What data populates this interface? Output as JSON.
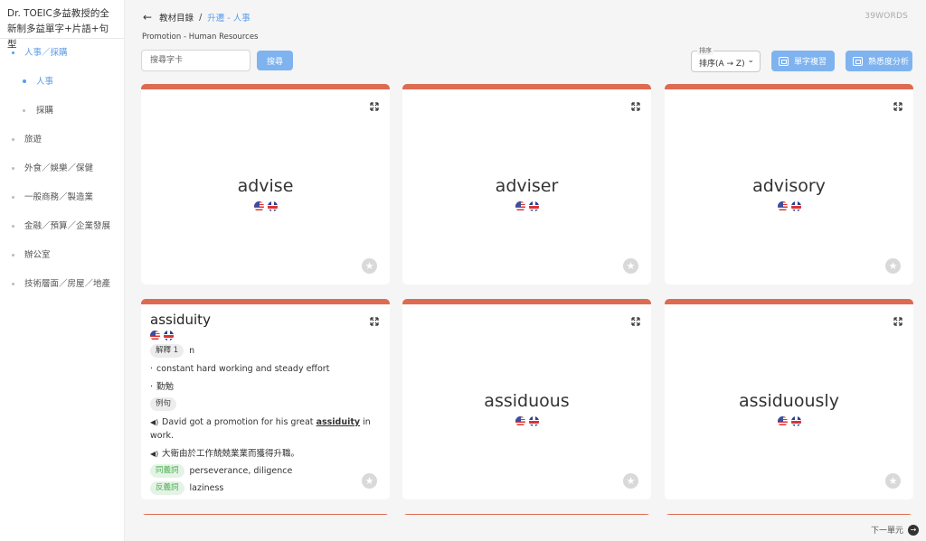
{
  "sidebar": {
    "title": "Dr. TOEIC多益教授的全新制多益單字+片語+句型",
    "items": [
      {
        "label": "人事／採購",
        "active": true
      },
      {
        "label": "人事",
        "active": true,
        "sub": true
      },
      {
        "label": "採購",
        "sub": true
      },
      {
        "label": "旅遊"
      },
      {
        "label": "外食／娛樂／保健"
      },
      {
        "label": "一般商務／製造業"
      },
      {
        "label": "金融／預算／企業發展"
      },
      {
        "label": "辦公室"
      },
      {
        "label": "技術層面／房屋／地產"
      }
    ]
  },
  "header": {
    "back_icon": "←",
    "breadcrumb_root": "教材目錄",
    "breadcrumb_sep": "/",
    "breadcrumb_current": "升遷 - 人事",
    "word_count": "39WORDS",
    "subtitle": "Promotion - Human Resources"
  },
  "toolbar": {
    "search_placeholder": "搜尋字卡",
    "search_button": "搜尋",
    "sort_legend": "排序",
    "sort_value": "排序(A → Z)",
    "sort_chevron": "⌄",
    "review_button": "單字複習",
    "analysis_button": "熟悉度分析"
  },
  "cards": [
    {
      "word": "advise"
    },
    {
      "word": "adviser"
    },
    {
      "word": "advisory"
    },
    {
      "word": "assiduity",
      "sense_chip": "解釋 1",
      "pos": "n",
      "definition_en": "constant hard working and steady effort",
      "definition_zh": "勤勉",
      "example_chip": "例句",
      "example_en_before": "David got a promotion for his great",
      "example_en_word": "assiduity",
      "example_en_after": "in work.",
      "example_zh": "大衛由於工作兢兢業業而獲得升職。",
      "synonym_chip": "同義詞",
      "synonyms": "perseverance, diligence",
      "antonym_chip": "反義詞",
      "antonyms": "laziness"
    },
    {
      "word": "assiduous"
    },
    {
      "word": "assiduously"
    }
  ],
  "footer": {
    "next_label": "下一單元",
    "next_icon": "→"
  },
  "colors": {
    "accent": "#5b9be8",
    "button": "#7eb3ef",
    "card_top": "#dd6b52"
  }
}
